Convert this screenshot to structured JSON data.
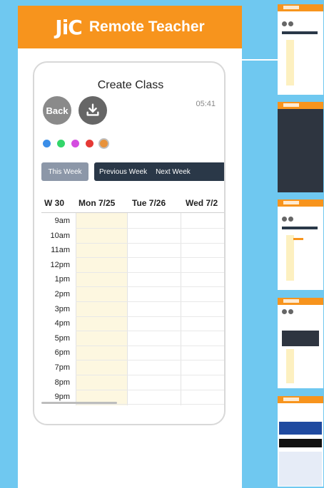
{
  "banner": {
    "logo_text": "JiC",
    "title": "Remote Teacher"
  },
  "screen": {
    "title": "Create Class",
    "back_label": "Back",
    "time": "05:41",
    "colors": [
      "#3b8ee8",
      "#33d66a",
      "#d44ce0",
      "#e53935",
      "#e8923a"
    ],
    "this_week": "This Week",
    "previous_week": "Previous Week",
    "next_week": "Next Week"
  },
  "calendar": {
    "week": "W 30",
    "days": [
      "Mon 7/25",
      "Tue 7/26",
      "Wed 7/2"
    ],
    "times": [
      "9am",
      "10am",
      "11am",
      "12pm",
      "1pm",
      "2pm",
      "3pm",
      "4pm",
      "5pm",
      "6pm",
      "7pm",
      "8pm",
      "9pm"
    ]
  },
  "icons": {
    "download": "download-icon"
  },
  "thumbnails": [
    "thumbnail-create-class",
    "thumbnail-dark-form",
    "thumbnail-schedule",
    "thumbnail-dialog",
    "thumbnail-blue-table"
  ]
}
